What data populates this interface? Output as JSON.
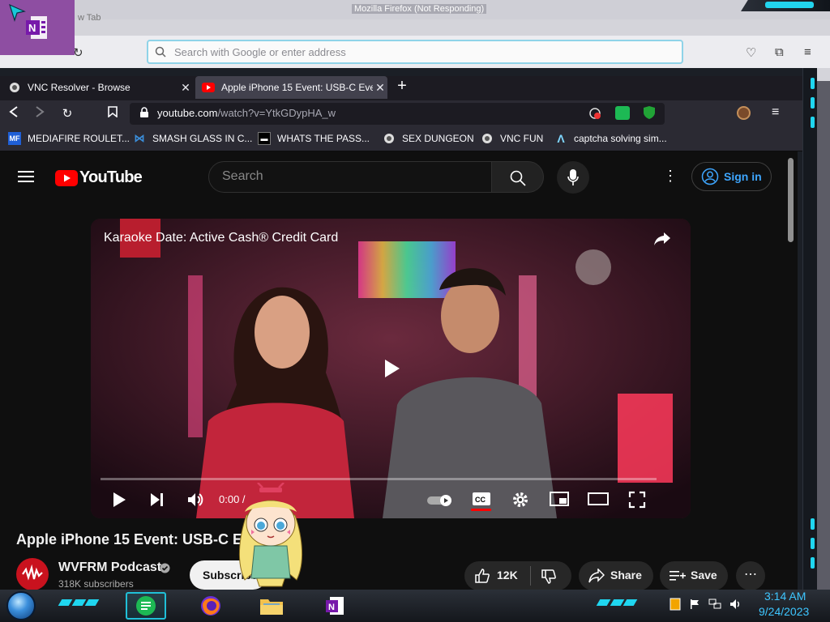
{
  "background_window": {
    "title": "Mozilla Firefox (Not Responding)",
    "tab_label": "w Tab",
    "search_placeholder": "Search with Google or enter address"
  },
  "browser": {
    "tabs": [
      {
        "label": "VNC Resolver - Browse",
        "active": false
      },
      {
        "label": "Apple iPhone 15 Event: USB-C Eve",
        "active": true
      }
    ],
    "url_host": "youtube.com",
    "url_path": "/watch?v=YtkGDypHA_w",
    "bookmarks": [
      {
        "label": "MEDIAFIRE ROULET...",
        "icon": "mediafire-icon"
      },
      {
        "label": "SMASH GLASS IN C...",
        "icon": "vs-icon"
      },
      {
        "label": "WHATS THE PASS...",
        "icon": "terminal-icon"
      },
      {
        "label": "SEX DUNGEON",
        "icon": "vnc-icon"
      },
      {
        "label": "VNC FUN",
        "icon": "vnc-icon"
      },
      {
        "label": "captcha solving sim...",
        "icon": "lambda-icon"
      }
    ]
  },
  "youtube": {
    "logo_text": "YouTube",
    "search_placeholder": "Search",
    "sign_in": "Sign in",
    "video": {
      "ad_title": "Karaoke Date: Active Cash® Credit Card",
      "time": "0:00 /",
      "title": "Apple iPhone 15 Event: USB-C E...!"
    },
    "channel": {
      "name": "WVFRM Podcast",
      "subscribers": "318K subscribers"
    },
    "subscribe": "Subscribe",
    "likes": "12K",
    "share": "Share",
    "save": "Save"
  },
  "taskbar": {
    "time": "3:14 AM",
    "date": "9/24/2023"
  },
  "colors": {
    "accent_cyan": "#1fd6f0",
    "youtube_red": "#ff0000",
    "link_blue": "#3ea6ff",
    "onenote_purple": "#8e4ea2"
  }
}
